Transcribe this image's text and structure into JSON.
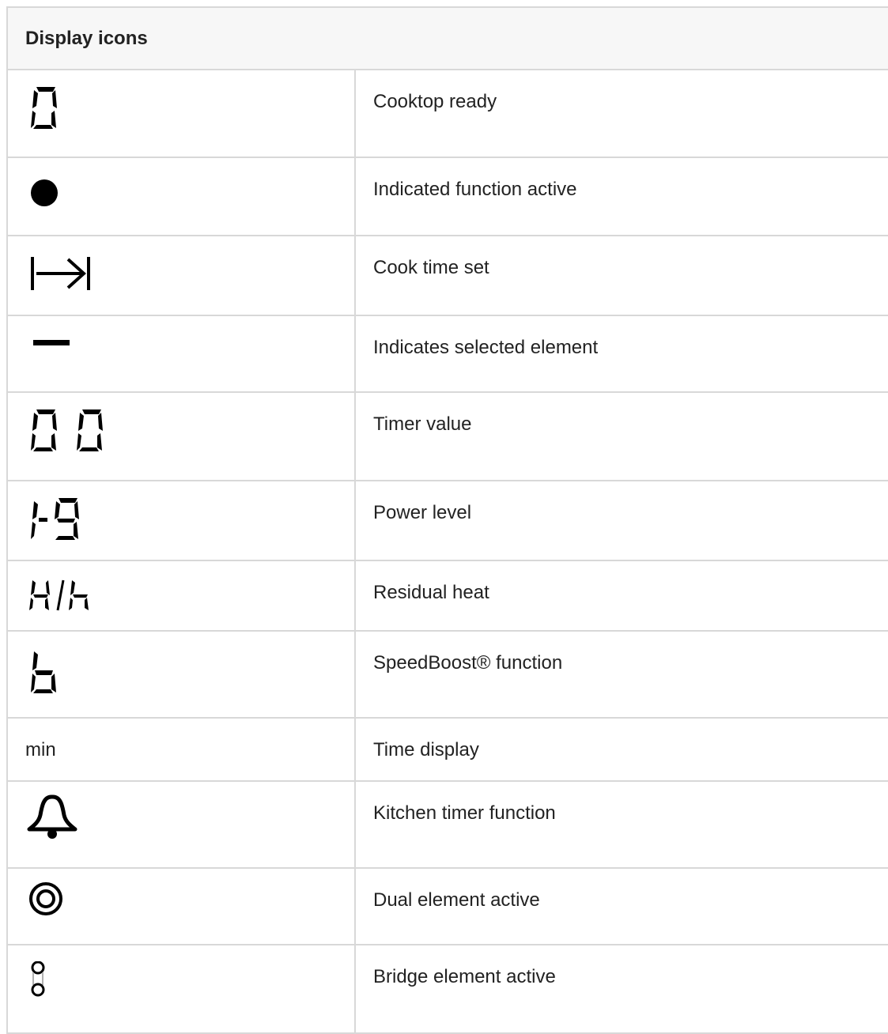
{
  "table": {
    "header": "Display icons",
    "rows": [
      {
        "icon": "seven-segment-zero-icon",
        "description": "Cooktop ready"
      },
      {
        "icon": "filled-dot-icon",
        "description": "Indicated function active"
      },
      {
        "icon": "cook-time-arrow-icon",
        "description": "Cook time set"
      },
      {
        "icon": "dash-icon",
        "description": "Indicates selected element"
      },
      {
        "icon": "seven-segment-double-zero-icon",
        "description": "Timer value"
      },
      {
        "icon": "seven-segment-1-9-icon",
        "description": "Power level"
      },
      {
        "icon": "seven-segment-h-icon",
        "description": "Residual heat"
      },
      {
        "icon": "seven-segment-b-icon",
        "description": "SpeedBoost® function"
      },
      {
        "icon_text": "min",
        "description": "Time display"
      },
      {
        "icon": "bell-icon",
        "description": "Kitchen timer function"
      },
      {
        "icon": "concentric-rings-icon",
        "description": "Dual element active"
      },
      {
        "icon": "bridge-circles-icon",
        "description": "Bridge element active"
      }
    ]
  }
}
